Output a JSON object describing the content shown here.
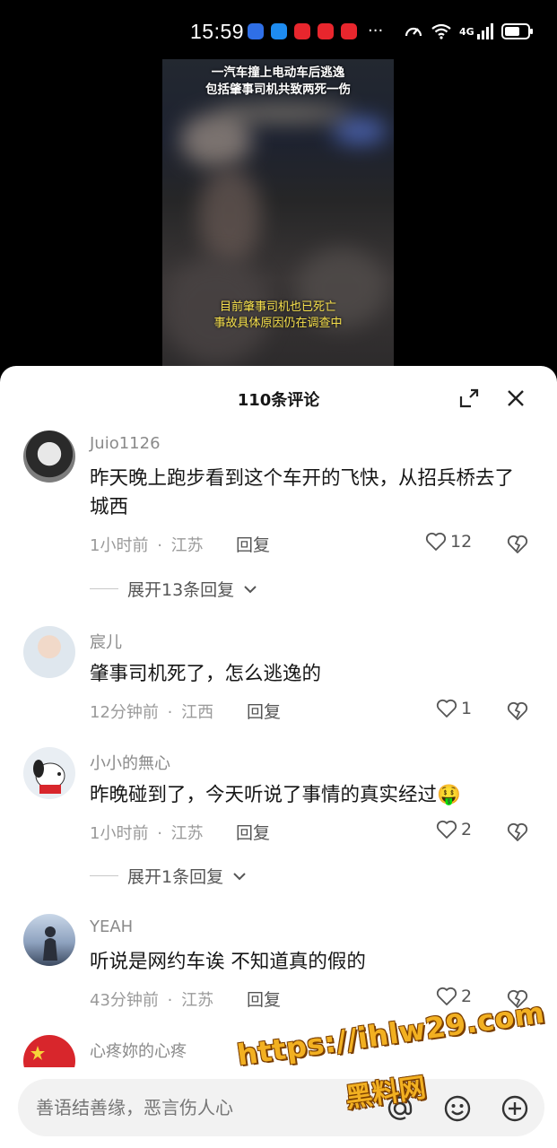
{
  "status_bar": {
    "time": "15:59",
    "network": "4G",
    "more": "···",
    "app_colors": [
      "#2f6fe6",
      "#1e8cf0",
      "#e8262d",
      "#e8262d",
      "#e8262d"
    ]
  },
  "video": {
    "caption_top": [
      "一汽车撞上电动车后逃逸",
      "包括肇事司机共致两死一伤"
    ],
    "caption_bottom": [
      "目前肇事司机也已死亡",
      "事故具体原因仍在调查中"
    ]
  },
  "comments_panel": {
    "title": "110条评论",
    "expand_icon": "expand-icon",
    "close_icon": "close-icon"
  },
  "comments": [
    {
      "user": "Juio1126",
      "text": "昨天晚上跑步看到这个车开的飞快，从招兵桥去了城西",
      "time": "1小时前",
      "location": "江苏",
      "reply_label": "回复",
      "likes": "12",
      "more_replies": "展开13条回复"
    },
    {
      "user": "宸儿",
      "text": "肇事司机死了，怎么逃逸的",
      "time": "12分钟前",
      "location": "江西",
      "reply_label": "回复",
      "likes": "1"
    },
    {
      "user": "小小的無心",
      "text": "昨晚碰到了，今天听说了事情的真实经过",
      "emoji": "🤑",
      "time": "1小时前",
      "location": "江苏",
      "reply_label": "回复",
      "likes": "2",
      "more_replies": "展开1条回复"
    },
    {
      "user": "YEAH",
      "text": "听说是网约车诶 不知道真的假的",
      "time": "43分钟前",
      "location": "江苏",
      "reply_label": "回复",
      "likes": "2"
    },
    {
      "user": "心疼妳的心疼"
    }
  ],
  "meta_sep": "·",
  "input": {
    "placeholder": "善语结善缘，恶言伤人心"
  },
  "watermark": {
    "line1": "https://ihlw29.com",
    "line2": "黑料网"
  }
}
